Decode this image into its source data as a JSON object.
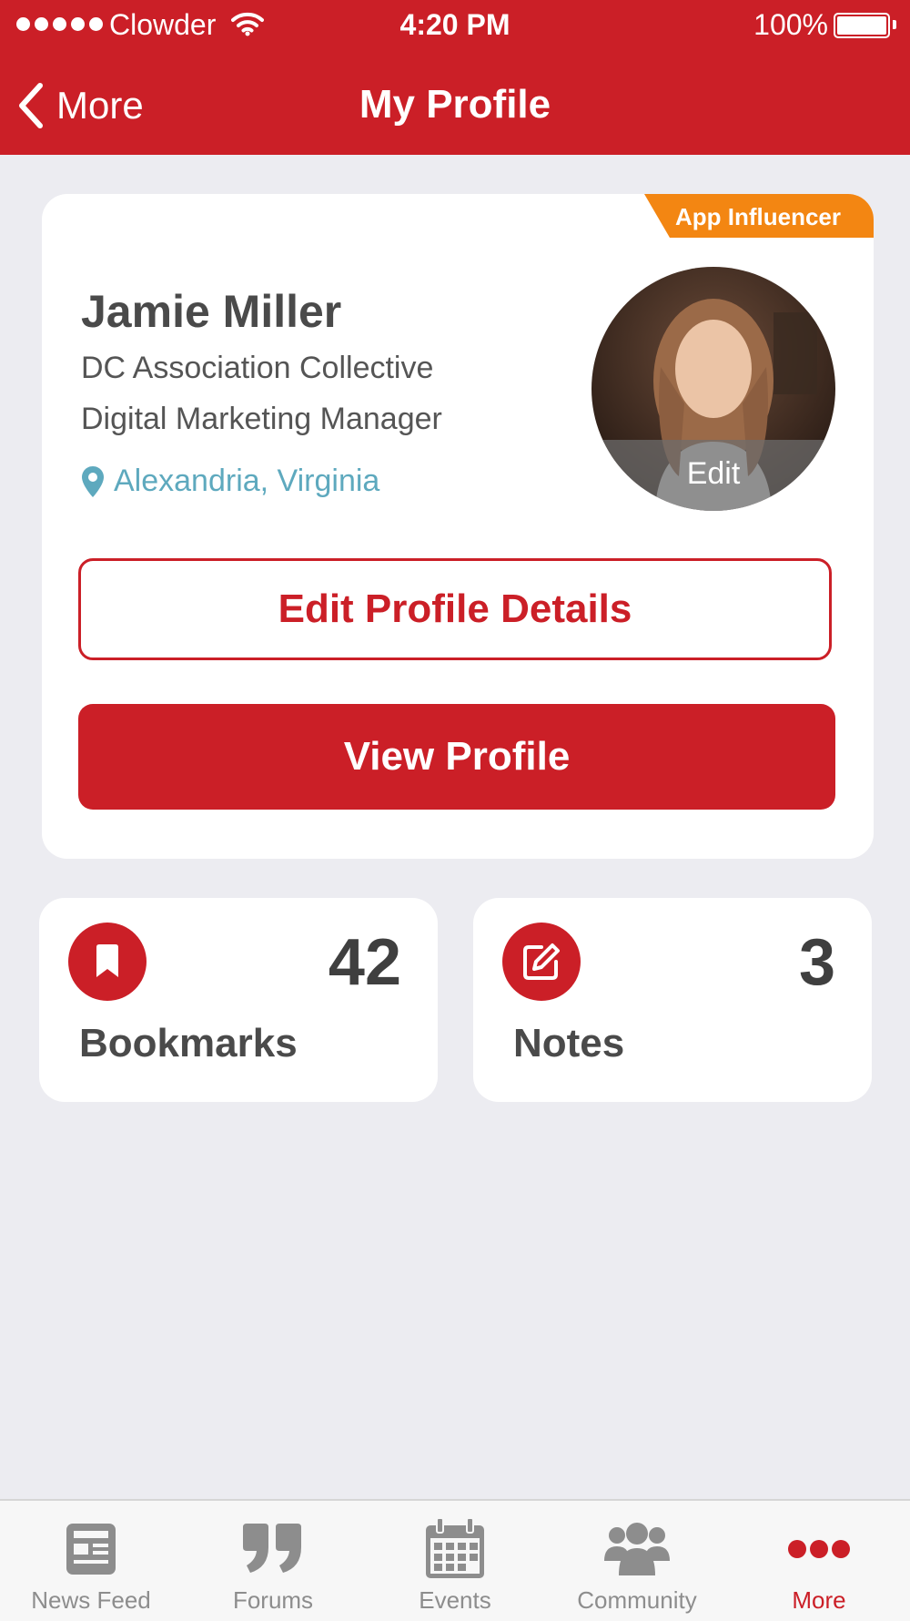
{
  "status_bar": {
    "carrier": "Clowder",
    "time": "4:20 PM",
    "battery": "100%"
  },
  "nav": {
    "back_label": "More",
    "title": "My Profile"
  },
  "profile": {
    "badge": "App Influencer",
    "name": "Jamie Miller",
    "organization": "DC Association Collective",
    "job_title": "Digital Marketing Manager",
    "location": "Alexandria, Virginia",
    "avatar_edit_label": "Edit",
    "edit_button_label": "Edit Profile Details",
    "view_button_label": "View Profile"
  },
  "stats": {
    "bookmarks": {
      "count": "42",
      "label": "Bookmarks",
      "icon": "bookmark-icon"
    },
    "notes": {
      "count": "3",
      "label": "Notes",
      "icon": "edit-note-icon"
    }
  },
  "tabs": [
    {
      "label": "News Feed",
      "icon": "news-feed-icon"
    },
    {
      "label": "Forums",
      "icon": "quote-icon"
    },
    {
      "label": "Events",
      "icon": "calendar-icon"
    },
    {
      "label": "Community",
      "icon": "people-icon"
    },
    {
      "label": "More",
      "icon": "more-dots-icon",
      "active": true
    }
  ],
  "colors": {
    "brand_red": "#CB1F27",
    "badge_orange": "#F38612",
    "location_blue": "#5EA9BE",
    "background": "#ECECF1",
    "tab_inactive": "#8D8D8D"
  }
}
